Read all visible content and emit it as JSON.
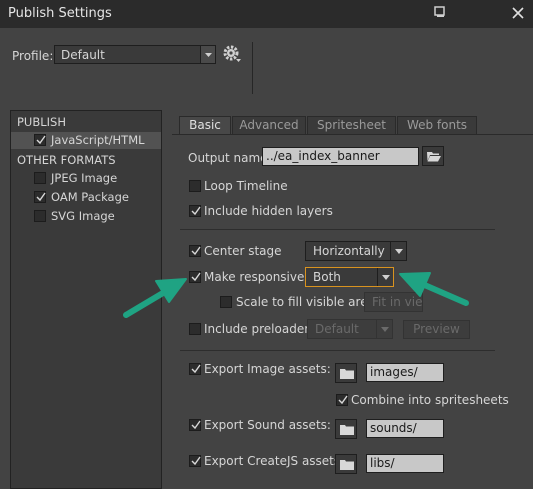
{
  "window": {
    "title": "Publish Settings"
  },
  "profile": {
    "label": "Profile:",
    "value": "Default"
  },
  "sidebar": {
    "publish_label": "PUBLISH",
    "publish_items": [
      {
        "label": "JavaScript/HTML",
        "checked": true
      }
    ],
    "other_label": "OTHER FORMATS",
    "other_items": [
      {
        "label": "JPEG Image",
        "checked": false
      },
      {
        "label": "OAM Package",
        "checked": true
      },
      {
        "label": "SVG Image",
        "checked": false
      }
    ]
  },
  "tabs": [
    "Basic",
    "Advanced",
    "Spritesheet",
    "Web fonts"
  ],
  "basic": {
    "output_label": "Output name:",
    "output_value": "../ea_index_banner",
    "loop_timeline": "Loop Timeline",
    "include_hidden": "Include hidden layers",
    "center_stage": "Center stage",
    "center_value": "Horizontally",
    "make_responsive": "Make responsive",
    "responsive_value": "Both",
    "scale_to_fill": "Scale to fill visible area",
    "scale_value": "Fit in view",
    "include_preloader": "Include preloader",
    "preloader_value": "Default",
    "preview_label": "Preview",
    "export_image": "Export Image assets:",
    "image_path": "images/",
    "combine_sprites": "Combine into spritesheets",
    "export_sound": "Export Sound assets:",
    "sound_path": "sounds/",
    "export_createjs": "Export CreateJS assets:",
    "createjs_path": "libs/"
  },
  "colors": {
    "background": "#434343",
    "highlight": "#d9931f",
    "arrow": "#1fa383"
  }
}
